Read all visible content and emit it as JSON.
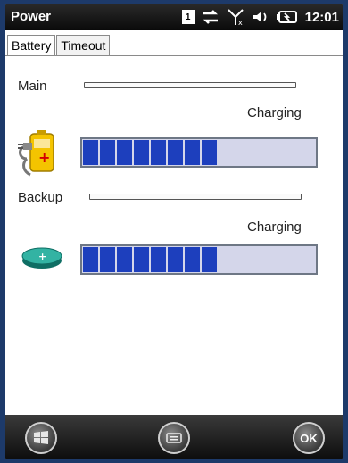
{
  "window": {
    "title": "Power",
    "time": "12:01",
    "notification_count": "1"
  },
  "tabs": [
    {
      "label": "Battery"
    },
    {
      "label": "Timeout"
    }
  ],
  "main_battery": {
    "label": "Main",
    "status": "Charging",
    "charge_percent": 62
  },
  "backup_battery": {
    "label": "Backup",
    "status": "Charging",
    "charge_percent": 62
  },
  "softkeys": {
    "ok_label": "OK"
  },
  "colors": {
    "progress_fill": "#1d3fbd",
    "progress_track": "#d4d6ea"
  }
}
